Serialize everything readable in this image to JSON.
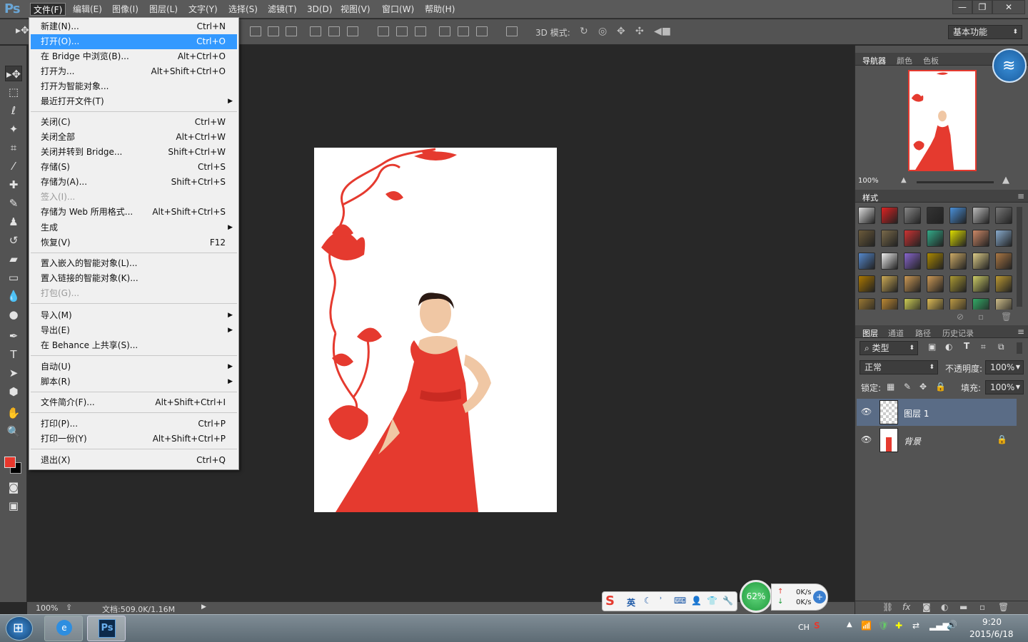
{
  "app": {
    "logo": "Ps"
  },
  "menubar": {
    "items": [
      {
        "label": "文件(F)"
      },
      {
        "label": "编辑(E)"
      },
      {
        "label": "图像(I)"
      },
      {
        "label": "图层(L)"
      },
      {
        "label": "文字(Y)"
      },
      {
        "label": "选择(S)"
      },
      {
        "label": "滤镜(T)"
      },
      {
        "label": "3D(D)"
      },
      {
        "label": "视图(V)"
      },
      {
        "label": "窗口(W)"
      },
      {
        "label": "帮助(H)"
      }
    ],
    "window_buttons": {
      "minimize": "—",
      "restore": "❐",
      "close": "✕"
    }
  },
  "optionsbar": {
    "mode_label": "3D 模式:",
    "workspace": "基本功能"
  },
  "file_menu": {
    "items": [
      {
        "label": "新建(N)...",
        "shortcut": "Ctrl+N"
      },
      {
        "label": "打开(O)...",
        "shortcut": "Ctrl+O"
      },
      {
        "label": "在 Bridge 中浏览(B)...",
        "shortcut": "Alt+Ctrl+O"
      },
      {
        "label": "打开为...",
        "shortcut": "Alt+Shift+Ctrl+O"
      },
      {
        "label": "打开为智能对象...",
        "shortcut": ""
      },
      {
        "label": "最近打开文件(T)",
        "shortcut": ""
      },
      {
        "label": "关闭(C)",
        "shortcut": "Ctrl+W"
      },
      {
        "label": "关闭全部",
        "shortcut": "Alt+Ctrl+W"
      },
      {
        "label": "关闭并转到 Bridge...",
        "shortcut": "Shift+Ctrl+W"
      },
      {
        "label": "存储(S)",
        "shortcut": "Ctrl+S"
      },
      {
        "label": "存储为(A)...",
        "shortcut": "Shift+Ctrl+S"
      },
      {
        "label": "签入(I)...",
        "shortcut": ""
      },
      {
        "label": "存储为 Web 所用格式...",
        "shortcut": "Alt+Shift+Ctrl+S"
      },
      {
        "label": "生成",
        "shortcut": ""
      },
      {
        "label": "恢复(V)",
        "shortcut": "F12"
      },
      {
        "label": "置入嵌入的智能对象(L)...",
        "shortcut": ""
      },
      {
        "label": "置入链接的智能对象(K)...",
        "shortcut": ""
      },
      {
        "label": "打包(G)...",
        "shortcut": ""
      },
      {
        "label": "导入(M)",
        "shortcut": ""
      },
      {
        "label": "导出(E)",
        "shortcut": ""
      },
      {
        "label": "在 Behance 上共享(S)...",
        "shortcut": ""
      },
      {
        "label": "自动(U)",
        "shortcut": ""
      },
      {
        "label": "脚本(R)",
        "shortcut": ""
      },
      {
        "label": "文件简介(F)...",
        "shortcut": "Alt+Shift+Ctrl+I"
      },
      {
        "label": "打印(P)...",
        "shortcut": "Ctrl+P"
      },
      {
        "label": "打印一份(Y)",
        "shortcut": "Alt+Shift+Ctrl+P"
      },
      {
        "label": "退出(X)",
        "shortcut": "Ctrl+Q"
      }
    ]
  },
  "statusbar": {
    "zoom": "100%",
    "doc_info": "文档:509.0K/1.16M"
  },
  "navigator": {
    "tabs": [
      "导航器",
      "颜色",
      "色板"
    ],
    "zoom": "100%"
  },
  "styles_panel": {
    "title": "样式"
  },
  "layers_panel": {
    "tabs": [
      "图层",
      "通道",
      "路径",
      "历史记录"
    ],
    "filter": "类型",
    "blend_mode": "正常",
    "opacity_label": "不透明度:",
    "opacity": "100%",
    "lock_label": "锁定:",
    "fill_label": "填充:",
    "fill": "100%",
    "layers": [
      {
        "name": "图层 1"
      },
      {
        "name": "背景"
      }
    ]
  },
  "widgets": {
    "ime_lang": "英",
    "net_percent": "62%",
    "upload": "0K/s",
    "download": "0K/s"
  },
  "taskbar": {
    "lang": "CH",
    "time": "9:20",
    "date": "2015/6/18"
  },
  "colors": {
    "foreground": "#e8372c",
    "background": "#000000",
    "menu_highlight": "#3399ff",
    "accent_red": "#e53a2f"
  }
}
